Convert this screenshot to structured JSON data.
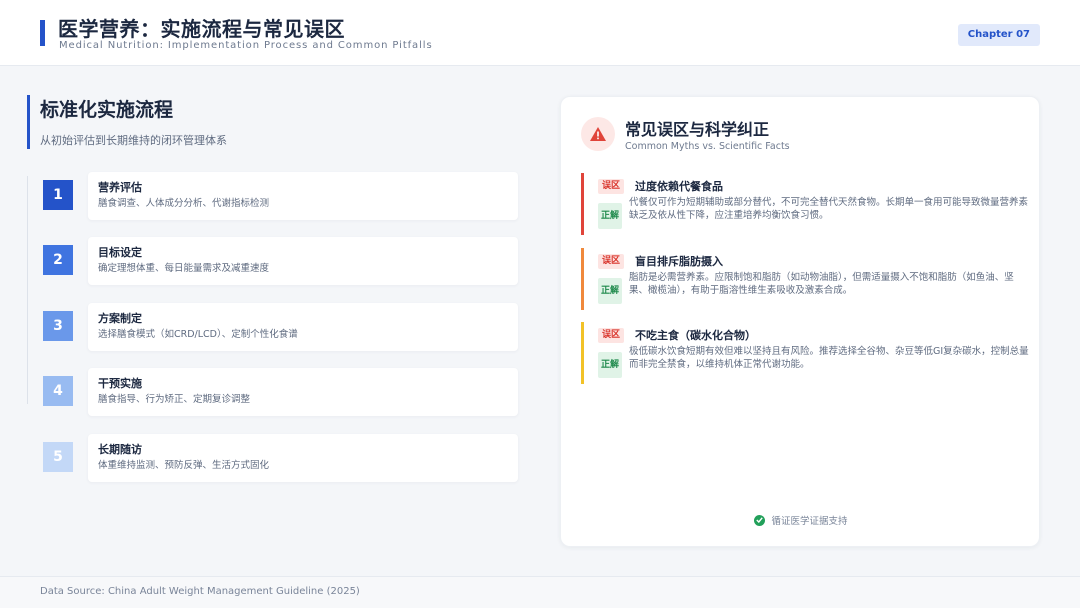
{
  "header": {
    "title": "医学营养：实施流程与常见误区",
    "subtitle": "Medical Nutrition: Implementation Process and Common Pitfalls",
    "chapter": "Chapter 07",
    "accent": "#2453c9"
  },
  "process": {
    "title": "标准化实施流程",
    "subtitle": "从初始评估到长期维持的闭环管理体系",
    "steps": [
      {
        "num": "1",
        "title": "营养评估",
        "desc": "膳食调查、人体成分分析、代谢指标检测",
        "color": "#2453c9"
      },
      {
        "num": "2",
        "title": "目标设定",
        "desc": "确定理想体重、每日能量需求及减重速度",
        "color": "#3f74e0"
      },
      {
        "num": "3",
        "title": "方案制定",
        "desc": "选择膳食模式（如CRD/LCD）、定制个性化食谱",
        "color": "#6a98ea"
      },
      {
        "num": "4",
        "title": "干预实施",
        "desc": "膳食指导、行为矫正、定期复诊调整",
        "color": "#98bbf1"
      },
      {
        "num": "5",
        "title": "长期随访",
        "desc": "体重维持监测、预防反弹、生活方式固化",
        "color": "#c3d8f7"
      }
    ]
  },
  "myths": {
    "title": "常见误区与科学纠正",
    "subtitle": "Common Myths vs. Scientific Facts",
    "myth_tag": "误区",
    "fact_tag": "正解",
    "items": [
      {
        "title": "过度依赖代餐食品",
        "fact": "代餐仅可作为短期辅助或部分替代，不可完全替代天然食物。长期单一食用可能导致微量营养素缺乏及依从性下降，应注重培养均衡饮食习惯。",
        "color": "#e0443a"
      },
      {
        "title": "盲目排斥脂肪摄入",
        "fact": "脂肪是必需营养素。应限制饱和脂肪（如动物油脂），但需适量摄入不饱和脂肪（如鱼油、坚果、橄榄油），有助于脂溶性维生素吸收及激素合成。",
        "color": "#f0893c"
      },
      {
        "title": "不吃主食（碳水化合物）",
        "fact": "极低碳水饮食短期有效但难以坚持且有风险。推荐选择全谷物、杂豆等低GI复杂碳水，控制总量而非完全禁食，以维持机体正常代谢功能。",
        "color": "#f2c227"
      }
    ],
    "footer": "循证医学证据支持"
  },
  "source": "Data Source: China Adult Weight Management Guideline (2025)"
}
